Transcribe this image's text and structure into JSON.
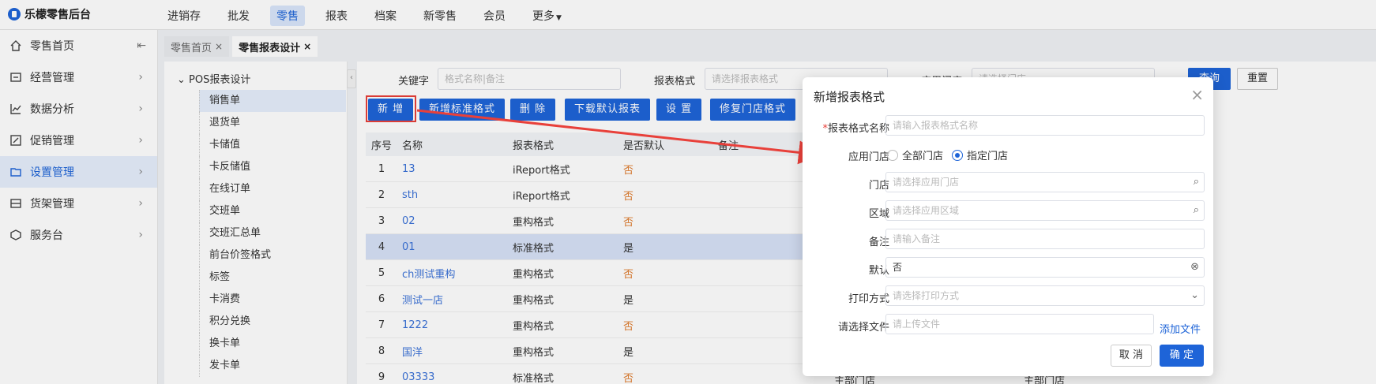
{
  "app": {
    "logo_text": "乐檬零售后台"
  },
  "topnav": [
    {
      "label": "进销存"
    },
    {
      "label": "批发"
    },
    {
      "label": "零售"
    },
    {
      "label": "报表"
    },
    {
      "label": "档案"
    },
    {
      "label": "新零售"
    },
    {
      "label": "会员"
    },
    {
      "label": "更多"
    }
  ],
  "sidebar": [
    {
      "label": "零售首页",
      "icon": "home-icon"
    },
    {
      "label": "经营管理",
      "icon": "dashboard-icon"
    },
    {
      "label": "数据分析",
      "icon": "chart-icon"
    },
    {
      "label": "促销管理",
      "icon": "promo-icon"
    },
    {
      "label": "设置管理",
      "icon": "folder-icon"
    },
    {
      "label": "货架管理",
      "icon": "shelf-icon"
    },
    {
      "label": "服务台",
      "icon": "service-icon"
    }
  ],
  "tabs": [
    {
      "label": "零售首页"
    },
    {
      "label": "零售报表设计"
    }
  ],
  "tree": {
    "root": "POS报表设计",
    "items": [
      "销售单",
      "退货单",
      "卡储值",
      "卡反储值",
      "在线订单",
      "交班单",
      "交班汇总单",
      "前台价签格式",
      "标签",
      "卡消费",
      "积分兑换",
      "换卡单",
      "发卡单"
    ]
  },
  "filters": {
    "keyword_label": "关键字",
    "keyword_placeholder": "格式名称|备注",
    "format_label": "报表格式",
    "format_placeholder": "请选择报表格式",
    "store_label": "应用门店",
    "store_placeholder": "请选择门店",
    "query_button": "查询",
    "reset_button": "重置"
  },
  "toolbar": {
    "add": "新 增",
    "add_standard": "新增标准格式",
    "delete": "删 除",
    "download": "下载默认报表",
    "settings": "设 置",
    "repair": "修复门店格式"
  },
  "table": {
    "headers": [
      "序号",
      "名称",
      "报表格式",
      "是否默认",
      "备注"
    ],
    "rows": [
      {
        "no": "1",
        "name": "13",
        "format": "iReport格式",
        "default": "否"
      },
      {
        "no": "2",
        "name": "sth",
        "format": "iReport格式",
        "default": "否"
      },
      {
        "no": "3",
        "name": "02",
        "format": "重构格式",
        "default": "否"
      },
      {
        "no": "4",
        "name": "01",
        "format": "标准格式",
        "default": "是"
      },
      {
        "no": "5",
        "name": "ch测试重构",
        "format": "重构格式",
        "default": "否"
      },
      {
        "no": "6",
        "name": "测试一店",
        "format": "重构格式",
        "default": "是"
      },
      {
        "no": "7",
        "name": "1222",
        "format": "重构格式",
        "default": "否"
      },
      {
        "no": "8",
        "name": "国洋",
        "format": "重构格式",
        "default": "是"
      },
      {
        "no": "9",
        "name": "03333",
        "format": "标准格式",
        "default": "否"
      }
    ],
    "trailing_a": "主部门店",
    "trailing_b": "主部门店"
  },
  "dialog": {
    "title": "新增报表格式",
    "name_label": "报表格式名称",
    "name_placeholder": "请输入报表格式名称",
    "store_label": "应用门店",
    "radio_all": "全部门店",
    "radio_specified": "指定门店",
    "store_field_label": "门店",
    "store_field_placeholder": "请选择应用门店",
    "region_label": "区域",
    "region_placeholder": "请选择应用区域",
    "note_label": "备注",
    "note_placeholder": "请输入备注",
    "default_label": "默认",
    "default_value": "否",
    "print_label": "打印方式",
    "print_placeholder": "请选择打印方式",
    "file_label": "请选择文件",
    "file_placeholder": "请上传文件",
    "add_file": "添加文件",
    "cancel": "取 消",
    "ok": "确 定"
  },
  "colors": {
    "primary": "#1e64d8",
    "highlight": "#e8403a",
    "no_value": "#e07b2c",
    "link": "#3b72d8"
  }
}
